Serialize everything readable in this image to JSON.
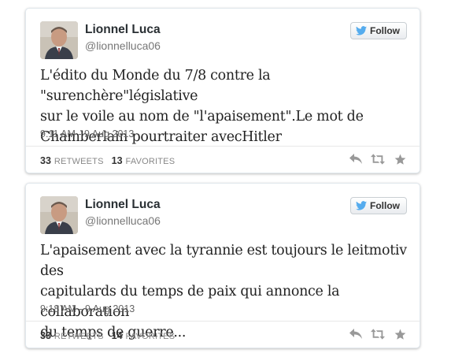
{
  "colors": {
    "twitter_blue": "#55acee",
    "action_icon": "#999999",
    "border": "#e1e8ed"
  },
  "tweets": [
    {
      "author_name": "Lionnel Luca",
      "handle": "@lionnelluca06",
      "follow_label": "Follow",
      "text": "L'édito du Monde du 7/8 contre la \"surenchère\"législative\nsur le voile au nom de \"l'apaisement\".Le mot de\nChamberlain pourtraiter avecHitler",
      "timestamp": "9:11 AM - 9 Aug 2013",
      "retweets_count": "33",
      "retweets_label": "RETWEETS",
      "favorites_count": "13",
      "favorites_label": "FAVORITES",
      "icons": [
        "avatar-photo",
        "twitter-bird-icon",
        "reply-icon",
        "retweet-icon",
        "favorite-star-icon"
      ]
    },
    {
      "author_name": "Lionnel Luca",
      "handle": "@lionnelluca06",
      "follow_label": "Follow",
      "text": "L'apaisement avec la tyrannie est toujours le leitmotiv des\ncapitulards du temps de paix qui annonce la collaboration\ndu temps de guerre...",
      "timestamp": "9:18 AM - 9 Aug 2013",
      "retweets_count": "33",
      "retweets_label": "RETWEETS",
      "favorites_count": "14",
      "favorites_label": "FAVORITES",
      "icons": [
        "avatar-photo",
        "twitter-bird-icon",
        "reply-icon",
        "retweet-icon",
        "favorite-star-icon"
      ]
    }
  ]
}
